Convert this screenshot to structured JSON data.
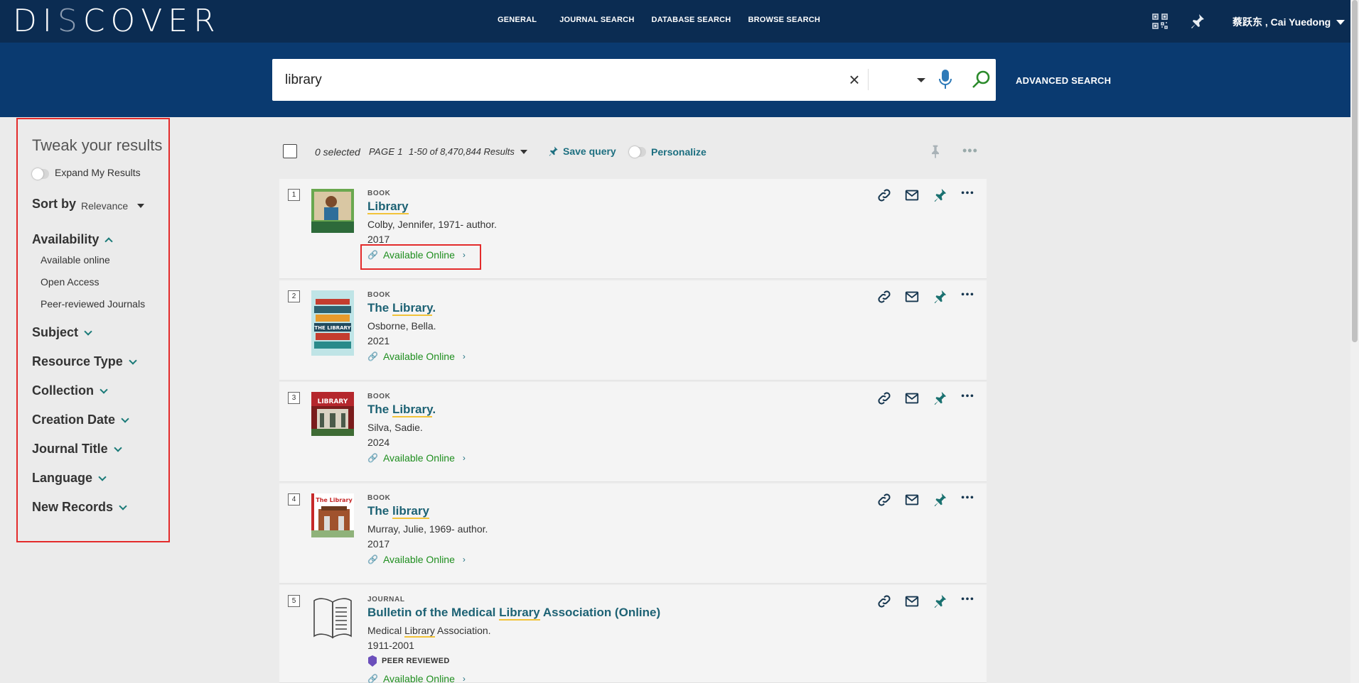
{
  "app": {
    "logo": [
      "D",
      "I",
      "S",
      "C",
      "O",
      "V",
      "E",
      "R"
    ],
    "nav": [
      "GENERAL",
      "JOURNAL SEARCH",
      "DATABASE SEARCH",
      "BROWSE SEARCH"
    ],
    "user": "蔡跃东 , Cai Yuedong"
  },
  "search": {
    "query": "library",
    "advanced_label": "ADVANCED SEARCH"
  },
  "facets": {
    "title": "Tweak your results",
    "expand_label": "Expand My Results",
    "sort_by_label": "Sort by",
    "sort_value": "Relevance",
    "availability": {
      "label": "Availability",
      "items": [
        "Available online",
        "Open Access",
        "Peer-reviewed Journals"
      ]
    },
    "groups": [
      "Subject",
      "Resource Type",
      "Collection",
      "Creation Date",
      "Journal Title",
      "Language",
      "New Records"
    ]
  },
  "toolbar": {
    "selected": "0 selected",
    "page": "PAGE 1",
    "results": "1-50 of 8,470,844 Results",
    "save_query": "Save query",
    "personalize": "Personalize"
  },
  "results": [
    {
      "rank": "1",
      "type": "BOOK",
      "title_hl": "Library",
      "title_rest": "",
      "line1": "Colby, Jennifer, 1971- author.",
      "line2": "2017",
      "avail": "Available Online"
    },
    {
      "rank": "2",
      "type": "BOOK",
      "title_pre": "The ",
      "title_hl": "Library",
      "title_rest": ".",
      "line1": "Osborne, Bella.",
      "line2": "2021",
      "avail": "Available Online"
    },
    {
      "rank": "3",
      "type": "BOOK",
      "title_pre": "The ",
      "title_hl": "Library",
      "title_rest": ".",
      "line1": "Silva, Sadie.",
      "line2": "2024",
      "avail": "Available Online"
    },
    {
      "rank": "4",
      "type": "BOOK",
      "title_pre": "The ",
      "title_hl": "library",
      "title_rest": "",
      "line1": "Murray, Julie, 1969- author.",
      "line2": "2017",
      "avail": "Available Online"
    },
    {
      "rank": "5",
      "type": "JOURNAL",
      "title_pre": "Bulletin of the Medical ",
      "title_hl": "Library",
      "title_rest": " Association (Online)",
      "line1_pre": "Medical ",
      "line1_hl": "Library",
      "line1_rest": " Association.",
      "line2": "1911-2001",
      "peer": "PEER REVIEWED",
      "avail": "Available Online"
    }
  ],
  "thumb_labels": {
    "r2": "THE LIBRARY",
    "r3": "LIBRARY",
    "r4": "The Library"
  }
}
